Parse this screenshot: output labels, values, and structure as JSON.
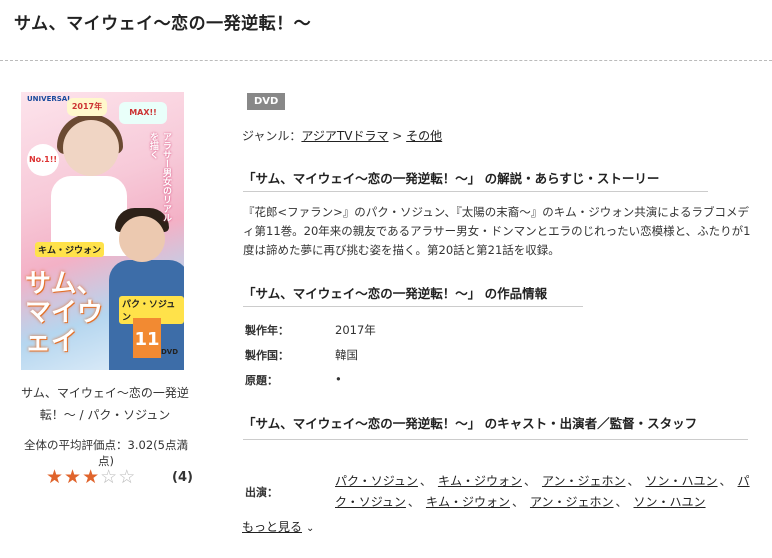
{
  "page": {
    "title": "サム、マイウェイ〜恋の一発逆転！〜"
  },
  "cover": {
    "alt": "サム、マイウェイ〜恋の一発逆転！〜 DVDジャケット",
    "logo": "UNIVERSAL",
    "badge_1": "No.1!!",
    "badge_2": "MAX!!",
    "badge_3": "2017年",
    "tagline": "アラサー男女のリアルを描く",
    "name_1": "キム・ジウォン",
    "name_2": "パク・ソジュン",
    "logo_title": "サム、マイウェイ",
    "vol": "11",
    "format_mark": "DVD"
  },
  "sidebar": {
    "caption_line1": "サム、マイウェイ〜恋の一発逆",
    "caption_line2": "転！〜 / パク・ソジュン",
    "avg_rating": "全体の平均評価点：3.02(5点満点)",
    "stars_filled": 3,
    "stars_total": 5,
    "review_count": "(4)"
  },
  "main": {
    "tag": "DVD",
    "genre_label": "ジャンル：",
    "genre_link1": "アジアTVドラマ",
    "genre_sep": " > ",
    "genre_link2": "その他",
    "section1_title": "「サム、マイウェイ〜恋の一発逆転！〜」 の解説・あらすじ・ストーリー",
    "synopsis": "『花郎<ファラン>』のパク・ソジュン、『太陽の末裔〜』のキム・ジウォン共演によるラブコメディ第11巻。20年来の親友であるアラサー男女・ドンマンとエラのじれったい恋模様と、ふたりが1度は諦めた夢に再び挑む姿を描く。第20話と第21話を収録。",
    "section2_title": "「サム、マイウェイ〜恋の一発逆転！〜」 の作品情報",
    "info": [
      {
        "label": "製作年：",
        "value": "2017年"
      },
      {
        "label": "製作国：",
        "value": "韓国"
      },
      {
        "label": "原題：",
        "value": "•"
      }
    ],
    "section3_title": "「サム、マイウェイ〜恋の一発逆転！〜」 のキャスト・出演者／監督・スタッフ",
    "cast_label": "出演：",
    "cast": [
      "パク・ソジュン",
      "キム・ジウォン",
      "アン・ジェホン",
      "ソン・ハユン",
      "パク・ソジュン",
      "キム・ジウォン",
      "アン・ジェホン",
      "ソン・ハユン"
    ],
    "cast_sep": "、",
    "more_label": "もっと見る",
    "more_icon": "chevron-down-icon"
  },
  "colors": {
    "star_on": "#e0642c",
    "star_off": "#bbbbbb",
    "tag_bg": "#888888"
  }
}
